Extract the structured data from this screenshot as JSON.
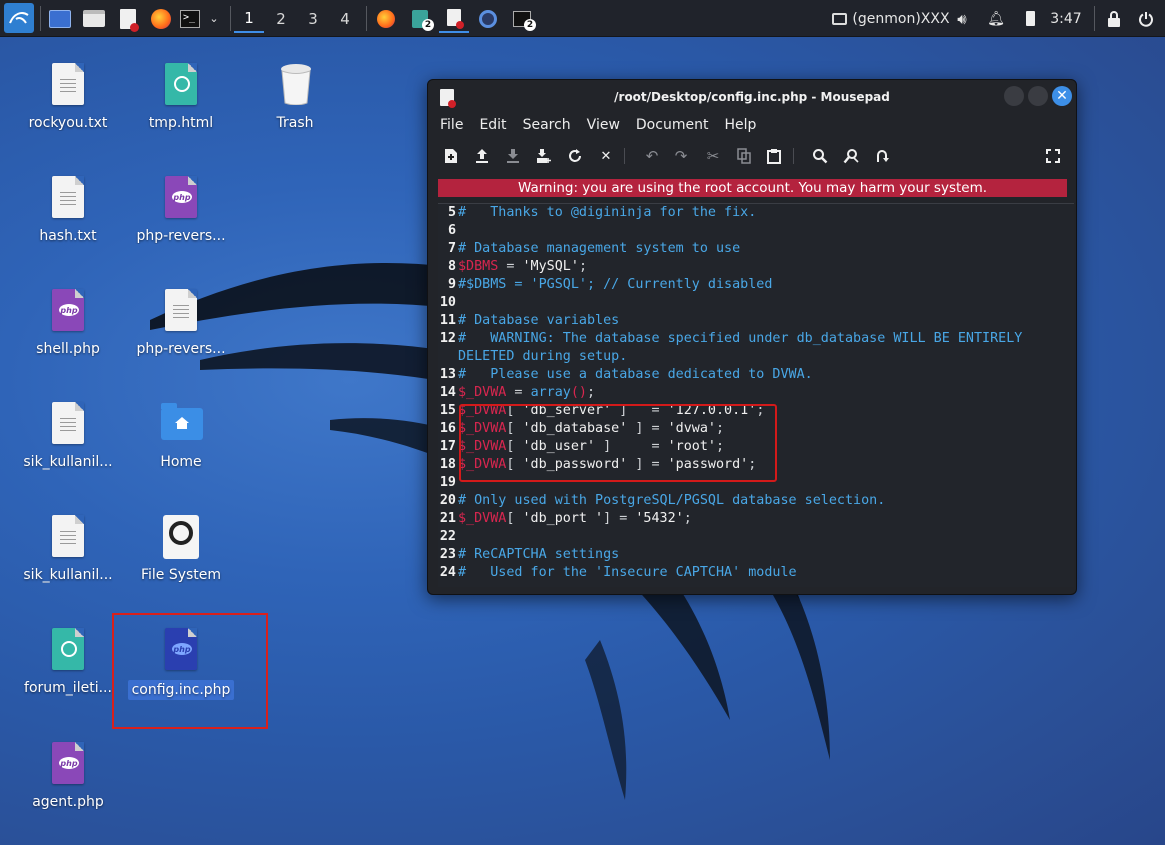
{
  "panel": {
    "workspaces": [
      "1",
      "2",
      "3",
      "4"
    ],
    "tray_label": "(genmon)XXX",
    "clock": "3:47",
    "task_badges": [
      "2",
      "2"
    ]
  },
  "desktop": {
    "icons": [
      {
        "label": "rockyou.txt",
        "type": "text-file"
      },
      {
        "label": "tmp.html",
        "type": "html-file"
      },
      {
        "label": "Trash",
        "type": "trash"
      },
      {
        "label": "hash.txt",
        "type": "text-file"
      },
      {
        "label": "php-revers...",
        "type": "php-file"
      },
      {
        "label": "shell.php",
        "type": "php-file"
      },
      {
        "label": "php-revers...",
        "type": "text-file"
      },
      {
        "label": "sik_kullanil...",
        "type": "text-file"
      },
      {
        "label": "Home",
        "type": "folder"
      },
      {
        "label": "sik_kullanil...",
        "type": "text-file"
      },
      {
        "label": "File System",
        "type": "drive"
      },
      {
        "label": "forum_ileti...",
        "type": "html-file"
      },
      {
        "label": "config.inc.php",
        "type": "php-file"
      },
      {
        "label": "agent.php",
        "type": "php-file"
      }
    ]
  },
  "window": {
    "title": "/root/Desktop/config.inc.php - Mousepad",
    "menu": [
      "File",
      "Edit",
      "Search",
      "View",
      "Document",
      "Help"
    ],
    "warning": "Warning: you are using the root account. You may harm your system.",
    "code": [
      {
        "n": "5",
        "parts": [
          [
            "com",
            "#   Thanks to @digininja for the fix."
          ]
        ]
      },
      {
        "n": "6",
        "parts": []
      },
      {
        "n": "7",
        "parts": [
          [
            "com",
            "# Database management system to use"
          ]
        ]
      },
      {
        "n": "8",
        "parts": [
          [
            "var",
            "$DBMS"
          ],
          [
            "op",
            " = "
          ],
          [
            "str",
            "'MySQL'"
          ],
          [
            "op",
            ";"
          ]
        ]
      },
      {
        "n": "9",
        "parts": [
          [
            "com",
            "#$DBMS = 'PGSQL'; // Currently disabled"
          ]
        ]
      },
      {
        "n": "10",
        "parts": []
      },
      {
        "n": "11",
        "parts": [
          [
            "com",
            "# Database variables"
          ]
        ]
      },
      {
        "n": "12",
        "parts": [
          [
            "com",
            "#   WARNING: The database specified under db_database WILL BE ENTIRELY"
          ]
        ]
      },
      {
        "n": "",
        "parts": [
          [
            "com",
            "DELETED during setup."
          ]
        ]
      },
      {
        "n": "13",
        "parts": [
          [
            "com",
            "#   Please use a database dedicated to DVWA."
          ]
        ]
      },
      {
        "n": "14",
        "parts": [
          [
            "var",
            "$_DVWA"
          ],
          [
            "op",
            " = "
          ],
          [
            "com",
            "array"
          ],
          [
            "var",
            "()"
          ],
          [
            "op",
            ";"
          ]
        ]
      },
      {
        "n": "15",
        "parts": [
          [
            "var",
            "$_DVWA"
          ],
          [
            "op",
            "[ "
          ],
          [
            "str",
            "'db_server'"
          ],
          [
            "op",
            " ]   = "
          ],
          [
            "str",
            "'127.0.0.1'"
          ],
          [
            "op",
            ";"
          ]
        ]
      },
      {
        "n": "16",
        "parts": [
          [
            "var",
            "$_DVWA"
          ],
          [
            "op",
            "[ "
          ],
          [
            "str",
            "'db_database'"
          ],
          [
            "op",
            " ] = "
          ],
          [
            "str",
            "'dvwa'"
          ],
          [
            "op",
            ";"
          ]
        ]
      },
      {
        "n": "17",
        "parts": [
          [
            "var",
            "$_DVWA"
          ],
          [
            "op",
            "[ "
          ],
          [
            "str",
            "'db_user'"
          ],
          [
            "op",
            " ]     = "
          ],
          [
            "str",
            "'root'"
          ],
          [
            "op",
            ";"
          ]
        ]
      },
      {
        "n": "18",
        "parts": [
          [
            "var",
            "$_DVWA"
          ],
          [
            "op",
            "[ "
          ],
          [
            "str",
            "'db_password'"
          ],
          [
            "op",
            " ] = "
          ],
          [
            "str",
            "'password'"
          ],
          [
            "op",
            ";"
          ]
        ]
      },
      {
        "n": "19",
        "parts": []
      },
      {
        "n": "20",
        "parts": [
          [
            "com",
            "# Only used with PostgreSQL/PGSQL database selection."
          ]
        ]
      },
      {
        "n": "21",
        "parts": [
          [
            "var",
            "$_DVWA"
          ],
          [
            "op",
            "[ "
          ],
          [
            "str",
            "'db_port '"
          ],
          [
            "op",
            "] = "
          ],
          [
            "str",
            "'5432'"
          ],
          [
            "op",
            ";"
          ]
        ]
      },
      {
        "n": "22",
        "parts": []
      },
      {
        "n": "23",
        "parts": [
          [
            "com",
            "# ReCAPTCHA settings"
          ]
        ]
      },
      {
        "n": "24",
        "parts": [
          [
            "com",
            "#   Used for the 'Insecure CAPTCHA' module"
          ]
        ]
      }
    ]
  },
  "colors": {
    "comment": "#49a7e6",
    "variable": "#d8264f",
    "warning_bg": "#b4233e",
    "highlight_box": "#d31a1a",
    "accent": "#3d8fe7"
  },
  "icons": [
    "kali-menu-icon",
    "terminal-icon",
    "firefox-icon",
    "files-icon",
    "mousepad-icon",
    "speaker-icon",
    "bell-icon",
    "battery-icon",
    "lock-icon",
    "power-icon"
  ]
}
